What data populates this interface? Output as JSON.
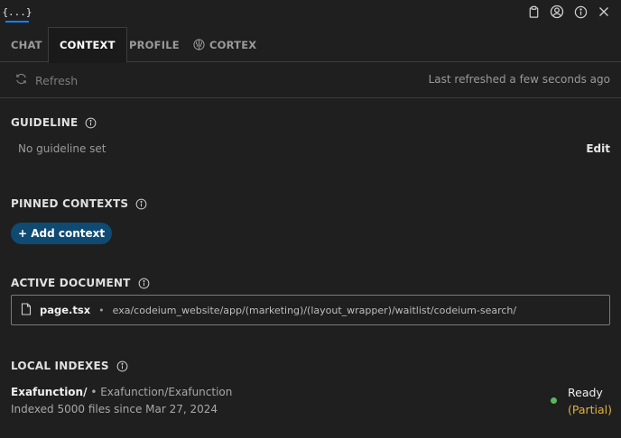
{
  "app": {
    "tab_label": "{...}"
  },
  "tabs": [
    {
      "label": "CHAT"
    },
    {
      "label": "CONTEXT"
    },
    {
      "label": "PROFILE"
    },
    {
      "label": "CORTEX"
    }
  ],
  "toolbar": {
    "refresh_label": "Refresh",
    "last_refreshed": "Last refreshed a few seconds ago"
  },
  "guideline": {
    "title": "GUIDELINE",
    "value": "No guideline set",
    "edit_label": "Edit"
  },
  "pinned": {
    "title": "PINNED CONTEXTS",
    "add_label": "+ Add context"
  },
  "active_document": {
    "title": "ACTIVE DOCUMENT",
    "file": "page.tsx",
    "separator": "•",
    "path": "exa/codeium_website/app/(marketing)/(layout_wrapper)/waitlist/codeium-search/"
  },
  "local_indexes": {
    "title": "LOCAL INDEXES",
    "name": "Exafunction/",
    "separator": "•",
    "repo": "Exafunction/Exafunction",
    "meta": "Indexed 5000 files since Mar 27, 2024",
    "status": "Ready",
    "status_detail": "(Partial)",
    "status_color": "#58b85c"
  },
  "colors": {
    "accent": "#0a84ff",
    "button_bg": "#0f4a73",
    "partial": "#e0b23a"
  }
}
